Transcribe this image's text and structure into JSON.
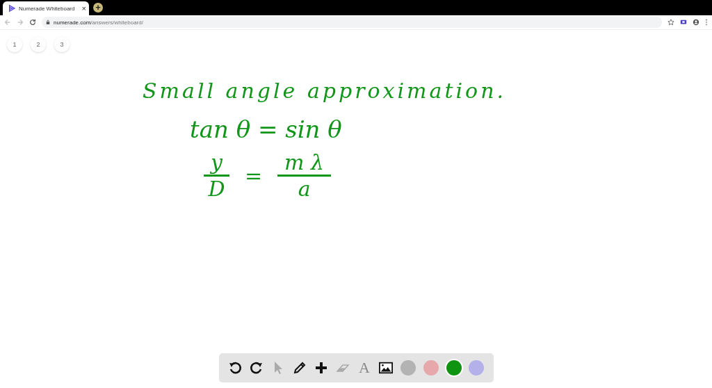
{
  "tab": {
    "title": "Numerade Whiteboard",
    "close": "×",
    "new_tab": "+"
  },
  "address_bar": {
    "domain": "numerade.com",
    "path": "/answers/whiteboard/"
  },
  "pages": [
    {
      "label": "1",
      "selected": false
    },
    {
      "label": "2",
      "selected": false
    },
    {
      "label": "3",
      "selected": false
    }
  ],
  "board": {
    "heading": "Small angle approximation.",
    "equation_1": "tan θ = sin θ",
    "equation_2": {
      "left_numerator": "y",
      "left_denominator": "D",
      "equals": "=",
      "right_numerator": "m λ",
      "right_denominator": "a"
    }
  },
  "tools": [
    {
      "kind": "undo",
      "disabled": false
    },
    {
      "kind": "redo",
      "disabled": false
    },
    {
      "kind": "pointer",
      "disabled": true
    },
    {
      "kind": "pencil",
      "disabled": false
    },
    {
      "kind": "plus",
      "disabled": false
    },
    {
      "kind": "eraser",
      "disabled": true
    },
    {
      "kind": "text",
      "label": "A",
      "disabled": true
    },
    {
      "kind": "image",
      "disabled": false
    }
  ],
  "colors": [
    {
      "color": "#b3b3b3",
      "selected": false
    },
    {
      "color": "#e6a8ab",
      "selected": false
    },
    {
      "color": "#0e9410",
      "selected": true
    },
    {
      "color": "#b3b0ea",
      "selected": false
    }
  ]
}
